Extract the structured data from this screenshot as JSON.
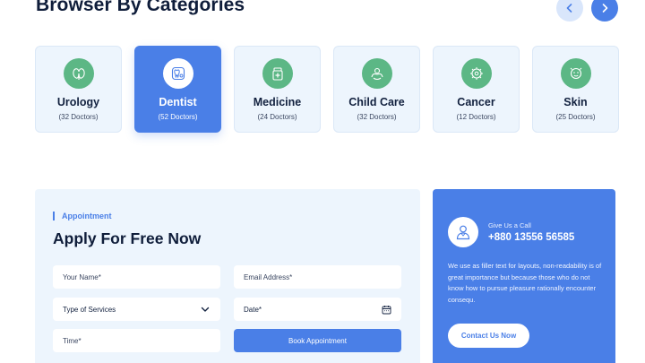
{
  "section": {
    "title": "Browser By Categories",
    "prev_icon": "chevron-left-icon",
    "next_icon": "chevron-right-icon"
  },
  "categories": [
    {
      "name": "Urology",
      "count": "(32 Doctors)",
      "icon": "urology-icon",
      "active": false
    },
    {
      "name": "Dentist",
      "count": "(52 Doctors)",
      "icon": "tooth-icon",
      "active": true
    },
    {
      "name": "Medicine",
      "count": "(24 Doctors)",
      "icon": "medicine-icon",
      "active": false
    },
    {
      "name": "Child Care",
      "count": "(32 Doctors)",
      "icon": "child-care-icon",
      "active": false
    },
    {
      "name": "Cancer",
      "count": "(12 Doctors)",
      "icon": "cancer-icon",
      "active": false
    },
    {
      "name": "Skin",
      "count": "(25 Doctors)",
      "icon": "skin-icon",
      "active": false
    }
  ],
  "appointment": {
    "eyebrow": "Appointment",
    "title": "Apply For Free Now",
    "name_placeholder": "Your Name*",
    "email_placeholder": "Email Address*",
    "service_select": "Type of Services",
    "date_placeholder": "Date*",
    "time_placeholder": "Time*",
    "submit_label": "Book Appointment"
  },
  "contact": {
    "call_label": "Give Us a Call",
    "phone": "+880 13556 56585",
    "blurb": "We use as filler text for layouts, non-readability is of great importance but because those who do not know how to pursue pleasure rationally encounter consequ.",
    "button_label": "Contact Us Now",
    "avatar_icon": "doctor-icon"
  },
  "colors": {
    "accent": "#4a7fe7",
    "icon_green": "#5cb785",
    "panel_bg": "#edf5fd",
    "heading": "#0f1d3a"
  }
}
